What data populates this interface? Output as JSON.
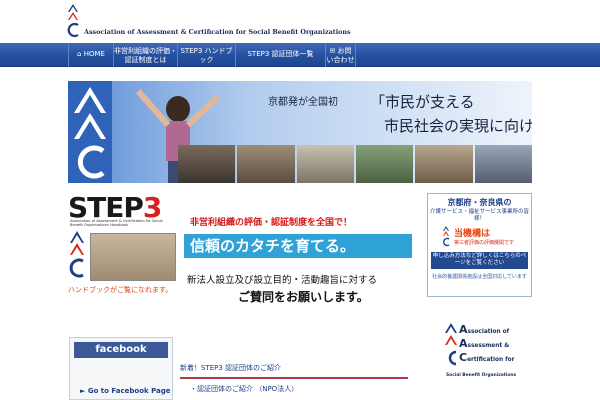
{
  "header": {
    "org_name": "Association of Assessment & Certification for Social Benefit Organizations"
  },
  "nav": {
    "home": "HOME",
    "ngo": "非営利組織の評価・認証制度とは",
    "step3": "STEP3 ハンドブック",
    "step3_org": "STEP3 認証団体一覧",
    "contact": "お問い合わせ"
  },
  "banner": {
    "tagline": "京都発が全国初",
    "headline1": "「市民が支える",
    "headline2": "市民社会の実現に向けて」"
  },
  "step3": {
    "title_step": "STEP",
    "title_num": "3",
    "subtitle": "Association of Assessment & Certification for Social Benefit Organizations Handbook",
    "handbook": "ハンドブックがご覧になれます。"
  },
  "promo": {
    "line1": "非営利組織の評価・認証制度を全国で！",
    "line2": "信頼のカタチを育てる。",
    "line3": "新法人設立及び設立目的・活動趣旨に対する",
    "line4": "ご賛同をお願いします。"
  },
  "notice": {
    "region": "京都府・奈良県の",
    "services": "介護サービス・福祉サービス事業所の皆様！",
    "highlight": "当機構は",
    "third_party": "第三者評価の評価機関です",
    "button": "申し込み方法など詳しくはこちらのページをご覧ください",
    "footer": "社会的養護関係施設は全国対応しています"
  },
  "facebook": {
    "brand": "facebook",
    "link": "► Go to Facebook Page"
  },
  "news": {
    "heading": "新着！STEP3 認証団体のご紹介",
    "item": "・認証団体のご紹介 （NPO法人）"
  },
  "org_logo": {
    "line1_cap": "A",
    "line1": "ssociation of",
    "line2_cap": "A",
    "line2": "ssessment &",
    "line3_cap": "C",
    "line3": "ertification for",
    "footer": "Social Benefit Organizations"
  },
  "colors": {
    "nav_blue": "#2550a0",
    "accent_red": "#d71818",
    "promo_blue": "#2fa2d8",
    "facebook_blue": "#3b5998"
  }
}
